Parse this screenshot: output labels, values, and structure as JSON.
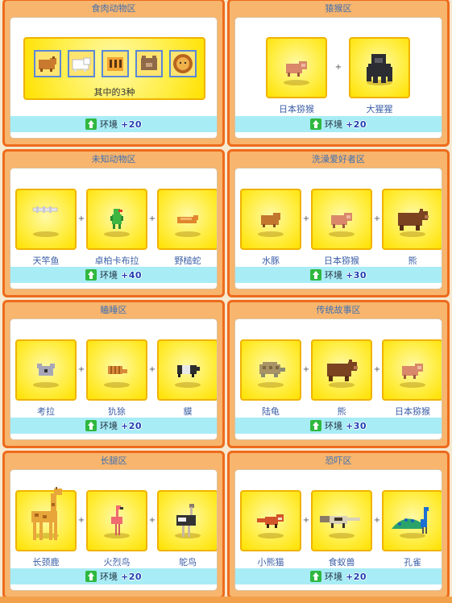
{
  "env_label": "环境",
  "zones": [
    {
      "title": "食肉动物区",
      "type": "group",
      "group_label": "其中的3种",
      "group_icons": [
        "wolf",
        "polar-bear",
        "tiger",
        "brown-bear",
        "lion"
      ],
      "env_value": "+20"
    },
    {
      "title": "猿猴区",
      "type": "slots",
      "animals": [
        {
          "name": "日本猕猴",
          "icon": "macaque"
        },
        {
          "name": "大猩猩",
          "icon": "gorilla"
        }
      ],
      "env_value": "+20"
    },
    {
      "title": "未知动物区",
      "type": "slots",
      "animals": [
        {
          "name": "天竿鱼",
          "icon": "skyfish"
        },
        {
          "name": "卓柏卡布拉",
          "icon": "chupacabra"
        },
        {
          "name": "野槌蛇",
          "icon": "tsuchinoko"
        }
      ],
      "env_value": "+40"
    },
    {
      "title": "洗澡爱好者区",
      "type": "slots",
      "animals": [
        {
          "name": "水豚",
          "icon": "capybara"
        },
        {
          "name": "日本猕猴",
          "icon": "macaque"
        },
        {
          "name": "熊",
          "icon": "bear"
        }
      ],
      "env_value": "+30"
    },
    {
      "title": "瞌睡区",
      "type": "slots",
      "animals": [
        {
          "name": "考拉",
          "icon": "koala"
        },
        {
          "name": "犰狳",
          "icon": "armadillo"
        },
        {
          "name": "貘",
          "icon": "tapir"
        }
      ],
      "env_value": "+20"
    },
    {
      "title": "传统故事区",
      "type": "slots",
      "animals": [
        {
          "name": "陆龟",
          "icon": "tortoise"
        },
        {
          "name": "熊",
          "icon": "bear"
        },
        {
          "name": "日本猕猴",
          "icon": "macaque"
        }
      ],
      "env_value": "+30"
    },
    {
      "title": "长腿区",
      "type": "slots",
      "animals": [
        {
          "name": "长颈鹿",
          "icon": "giraffe"
        },
        {
          "name": "火烈鸟",
          "icon": "flamingo"
        },
        {
          "name": "鸵鸟",
          "icon": "ostrich"
        }
      ],
      "env_value": "+20"
    },
    {
      "title": "恐吓区",
      "type": "slots",
      "animals": [
        {
          "name": "小熊猫",
          "icon": "red-panda"
        },
        {
          "name": "食蚁兽",
          "icon": "anteater"
        },
        {
          "name": "孔雀",
          "icon": "peacock"
        }
      ],
      "env_value": "+20"
    }
  ],
  "plus_sign": "+"
}
